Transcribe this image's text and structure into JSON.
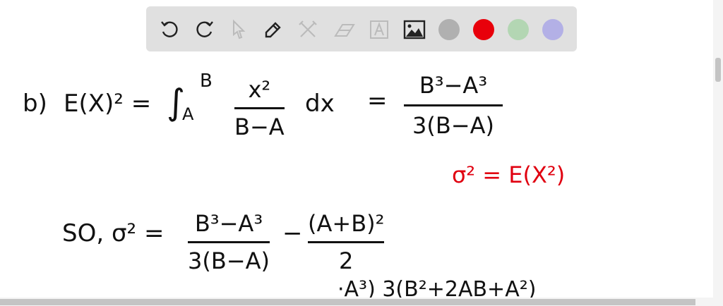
{
  "toolbar": {
    "tools": [
      "undo-icon",
      "redo-icon",
      "select-icon",
      "pen-icon",
      "tools-icon",
      "eraser-icon",
      "text-icon",
      "image-icon"
    ],
    "colors": [
      "#b0b0b0",
      "#e8000b",
      "#b3d6b3",
      "#b3b0e6"
    ]
  },
  "board": {
    "line1": {
      "label": "b)",
      "lhs": "E(X)² =",
      "integral": "∫",
      "lower": "A",
      "upper": "B",
      "num": "x²",
      "den": "B−A",
      "dx": "dx",
      "eq": "=",
      "rnum": "B³−A³",
      "rden": "3(B−A)"
    },
    "red_note": "σ² = E(X²)",
    "line2": {
      "lhs": "SO, σ² =",
      "num1": "B³−A³",
      "den1": "3(B−A)",
      "minus": "−",
      "num2": "(A+B)²",
      "den2": "2"
    },
    "line3": "·A³)   3(B²+2AB+A²)"
  }
}
